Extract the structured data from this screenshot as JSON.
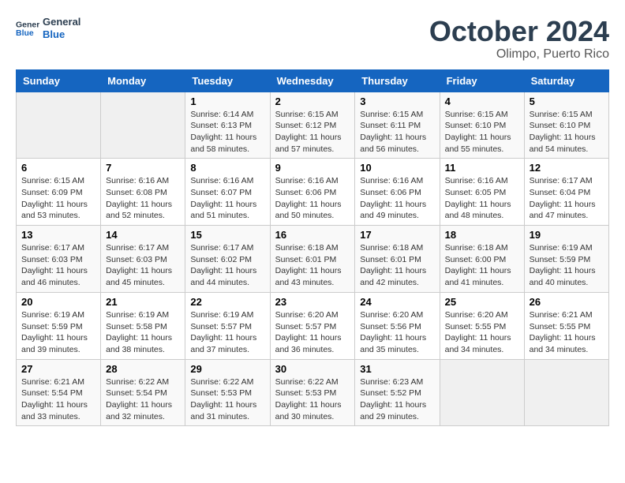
{
  "header": {
    "logo_general": "General",
    "logo_blue": "Blue",
    "month": "October 2024",
    "location": "Olimpo, Puerto Rico"
  },
  "days_of_week": [
    "Sunday",
    "Monday",
    "Tuesday",
    "Wednesday",
    "Thursday",
    "Friday",
    "Saturday"
  ],
  "weeks": [
    [
      {
        "day": "",
        "sunrise": "",
        "sunset": "",
        "daylight": ""
      },
      {
        "day": "",
        "sunrise": "",
        "sunset": "",
        "daylight": ""
      },
      {
        "day": "1",
        "sunrise": "Sunrise: 6:14 AM",
        "sunset": "Sunset: 6:13 PM",
        "daylight": "Daylight: 11 hours and 58 minutes."
      },
      {
        "day": "2",
        "sunrise": "Sunrise: 6:15 AM",
        "sunset": "Sunset: 6:12 PM",
        "daylight": "Daylight: 11 hours and 57 minutes."
      },
      {
        "day": "3",
        "sunrise": "Sunrise: 6:15 AM",
        "sunset": "Sunset: 6:11 PM",
        "daylight": "Daylight: 11 hours and 56 minutes."
      },
      {
        "day": "4",
        "sunrise": "Sunrise: 6:15 AM",
        "sunset": "Sunset: 6:10 PM",
        "daylight": "Daylight: 11 hours and 55 minutes."
      },
      {
        "day": "5",
        "sunrise": "Sunrise: 6:15 AM",
        "sunset": "Sunset: 6:10 PM",
        "daylight": "Daylight: 11 hours and 54 minutes."
      }
    ],
    [
      {
        "day": "6",
        "sunrise": "Sunrise: 6:15 AM",
        "sunset": "Sunset: 6:09 PM",
        "daylight": "Daylight: 11 hours and 53 minutes."
      },
      {
        "day": "7",
        "sunrise": "Sunrise: 6:16 AM",
        "sunset": "Sunset: 6:08 PM",
        "daylight": "Daylight: 11 hours and 52 minutes."
      },
      {
        "day": "8",
        "sunrise": "Sunrise: 6:16 AM",
        "sunset": "Sunset: 6:07 PM",
        "daylight": "Daylight: 11 hours and 51 minutes."
      },
      {
        "day": "9",
        "sunrise": "Sunrise: 6:16 AM",
        "sunset": "Sunset: 6:06 PM",
        "daylight": "Daylight: 11 hours and 50 minutes."
      },
      {
        "day": "10",
        "sunrise": "Sunrise: 6:16 AM",
        "sunset": "Sunset: 6:06 PM",
        "daylight": "Daylight: 11 hours and 49 minutes."
      },
      {
        "day": "11",
        "sunrise": "Sunrise: 6:16 AM",
        "sunset": "Sunset: 6:05 PM",
        "daylight": "Daylight: 11 hours and 48 minutes."
      },
      {
        "day": "12",
        "sunrise": "Sunrise: 6:17 AM",
        "sunset": "Sunset: 6:04 PM",
        "daylight": "Daylight: 11 hours and 47 minutes."
      }
    ],
    [
      {
        "day": "13",
        "sunrise": "Sunrise: 6:17 AM",
        "sunset": "Sunset: 6:03 PM",
        "daylight": "Daylight: 11 hours and 46 minutes."
      },
      {
        "day": "14",
        "sunrise": "Sunrise: 6:17 AM",
        "sunset": "Sunset: 6:03 PM",
        "daylight": "Daylight: 11 hours and 45 minutes."
      },
      {
        "day": "15",
        "sunrise": "Sunrise: 6:17 AM",
        "sunset": "Sunset: 6:02 PM",
        "daylight": "Daylight: 11 hours and 44 minutes."
      },
      {
        "day": "16",
        "sunrise": "Sunrise: 6:18 AM",
        "sunset": "Sunset: 6:01 PM",
        "daylight": "Daylight: 11 hours and 43 minutes."
      },
      {
        "day": "17",
        "sunrise": "Sunrise: 6:18 AM",
        "sunset": "Sunset: 6:01 PM",
        "daylight": "Daylight: 11 hours and 42 minutes."
      },
      {
        "day": "18",
        "sunrise": "Sunrise: 6:18 AM",
        "sunset": "Sunset: 6:00 PM",
        "daylight": "Daylight: 11 hours and 41 minutes."
      },
      {
        "day": "19",
        "sunrise": "Sunrise: 6:19 AM",
        "sunset": "Sunset: 5:59 PM",
        "daylight": "Daylight: 11 hours and 40 minutes."
      }
    ],
    [
      {
        "day": "20",
        "sunrise": "Sunrise: 6:19 AM",
        "sunset": "Sunset: 5:59 PM",
        "daylight": "Daylight: 11 hours and 39 minutes."
      },
      {
        "day": "21",
        "sunrise": "Sunrise: 6:19 AM",
        "sunset": "Sunset: 5:58 PM",
        "daylight": "Daylight: 11 hours and 38 minutes."
      },
      {
        "day": "22",
        "sunrise": "Sunrise: 6:19 AM",
        "sunset": "Sunset: 5:57 PM",
        "daylight": "Daylight: 11 hours and 37 minutes."
      },
      {
        "day": "23",
        "sunrise": "Sunrise: 6:20 AM",
        "sunset": "Sunset: 5:57 PM",
        "daylight": "Daylight: 11 hours and 36 minutes."
      },
      {
        "day": "24",
        "sunrise": "Sunrise: 6:20 AM",
        "sunset": "Sunset: 5:56 PM",
        "daylight": "Daylight: 11 hours and 35 minutes."
      },
      {
        "day": "25",
        "sunrise": "Sunrise: 6:20 AM",
        "sunset": "Sunset: 5:55 PM",
        "daylight": "Daylight: 11 hours and 34 minutes."
      },
      {
        "day": "26",
        "sunrise": "Sunrise: 6:21 AM",
        "sunset": "Sunset: 5:55 PM",
        "daylight": "Daylight: 11 hours and 34 minutes."
      }
    ],
    [
      {
        "day": "27",
        "sunrise": "Sunrise: 6:21 AM",
        "sunset": "Sunset: 5:54 PM",
        "daylight": "Daylight: 11 hours and 33 minutes."
      },
      {
        "day": "28",
        "sunrise": "Sunrise: 6:22 AM",
        "sunset": "Sunset: 5:54 PM",
        "daylight": "Daylight: 11 hours and 32 minutes."
      },
      {
        "day": "29",
        "sunrise": "Sunrise: 6:22 AM",
        "sunset": "Sunset: 5:53 PM",
        "daylight": "Daylight: 11 hours and 31 minutes."
      },
      {
        "day": "30",
        "sunrise": "Sunrise: 6:22 AM",
        "sunset": "Sunset: 5:53 PM",
        "daylight": "Daylight: 11 hours and 30 minutes."
      },
      {
        "day": "31",
        "sunrise": "Sunrise: 6:23 AM",
        "sunset": "Sunset: 5:52 PM",
        "daylight": "Daylight: 11 hours and 29 minutes."
      },
      {
        "day": "",
        "sunrise": "",
        "sunset": "",
        "daylight": ""
      },
      {
        "day": "",
        "sunrise": "",
        "sunset": "",
        "daylight": ""
      }
    ]
  ]
}
